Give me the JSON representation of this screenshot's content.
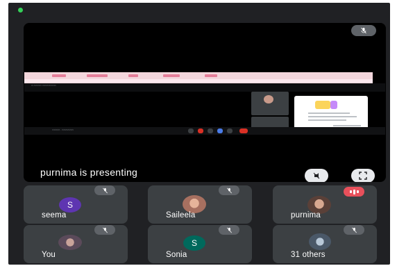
{
  "stage": {
    "presenting_label": "purnima is presenting",
    "mute_icon": "mic-off-icon",
    "unpin_icon": "unpin-icon",
    "fullscreen_icon": "fullscreen-icon"
  },
  "participants": [
    {
      "name": "seema",
      "initial": "S",
      "avatar_color": "#5e35b1",
      "muted": true
    },
    {
      "name": "Saileela",
      "initial": "",
      "avatar_color": "#a77060",
      "muted": true
    },
    {
      "name": "purnima",
      "initial": "",
      "avatar_color": "#8b6a5a",
      "speaking": true
    },
    {
      "name": "You",
      "initial": "",
      "avatar_color": "#7a6b7a",
      "muted": true
    },
    {
      "name": "Sonia",
      "initial": "S",
      "avatar_color": "#00695c",
      "muted": true
    },
    {
      "name": "31 others",
      "initial": "",
      "avatar_color": "#6e7f94",
      "muted": true
    }
  ],
  "colors": {
    "background": "#202124",
    "tile": "#3c4043",
    "pill": "#5f6368",
    "speaking": "#e8505b",
    "status": "#34d058"
  }
}
